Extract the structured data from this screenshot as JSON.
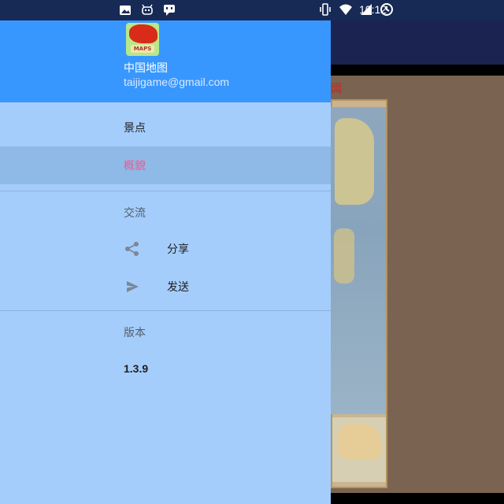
{
  "status_bar": {
    "time": "10:12",
    "left_icons": [
      "image-icon",
      "android-robot-icon",
      "chat-icon"
    ],
    "right_icons": [
      "vibrate-icon",
      "wifi-icon",
      "signal-icon",
      "data-saver-icon"
    ]
  },
  "drawer": {
    "header": {
      "app_logo_text": "MAPS",
      "app_name": "中国地图",
      "email": "taijigame@gmail.com"
    },
    "items": [
      {
        "label": "景点"
      },
      {
        "label": "概貌",
        "active": true
      }
    ],
    "sections": [
      {
        "title": "交流",
        "items": [
          {
            "label": "分享",
            "icon": "share-icon"
          },
          {
            "label": "发送",
            "icon": "send-icon"
          }
        ]
      },
      {
        "title": "版本",
        "value": "1.3.9"
      }
    ],
    "colors": {
      "header": "#3897ff",
      "body": "#a5cdfb",
      "active_bg": "#8fb9e6",
      "active_text": "#e25f95"
    }
  },
  "background_app": {
    "toolbar_color": "#1b2450",
    "content_color": "#7a6350",
    "corner_glyph": "図"
  }
}
